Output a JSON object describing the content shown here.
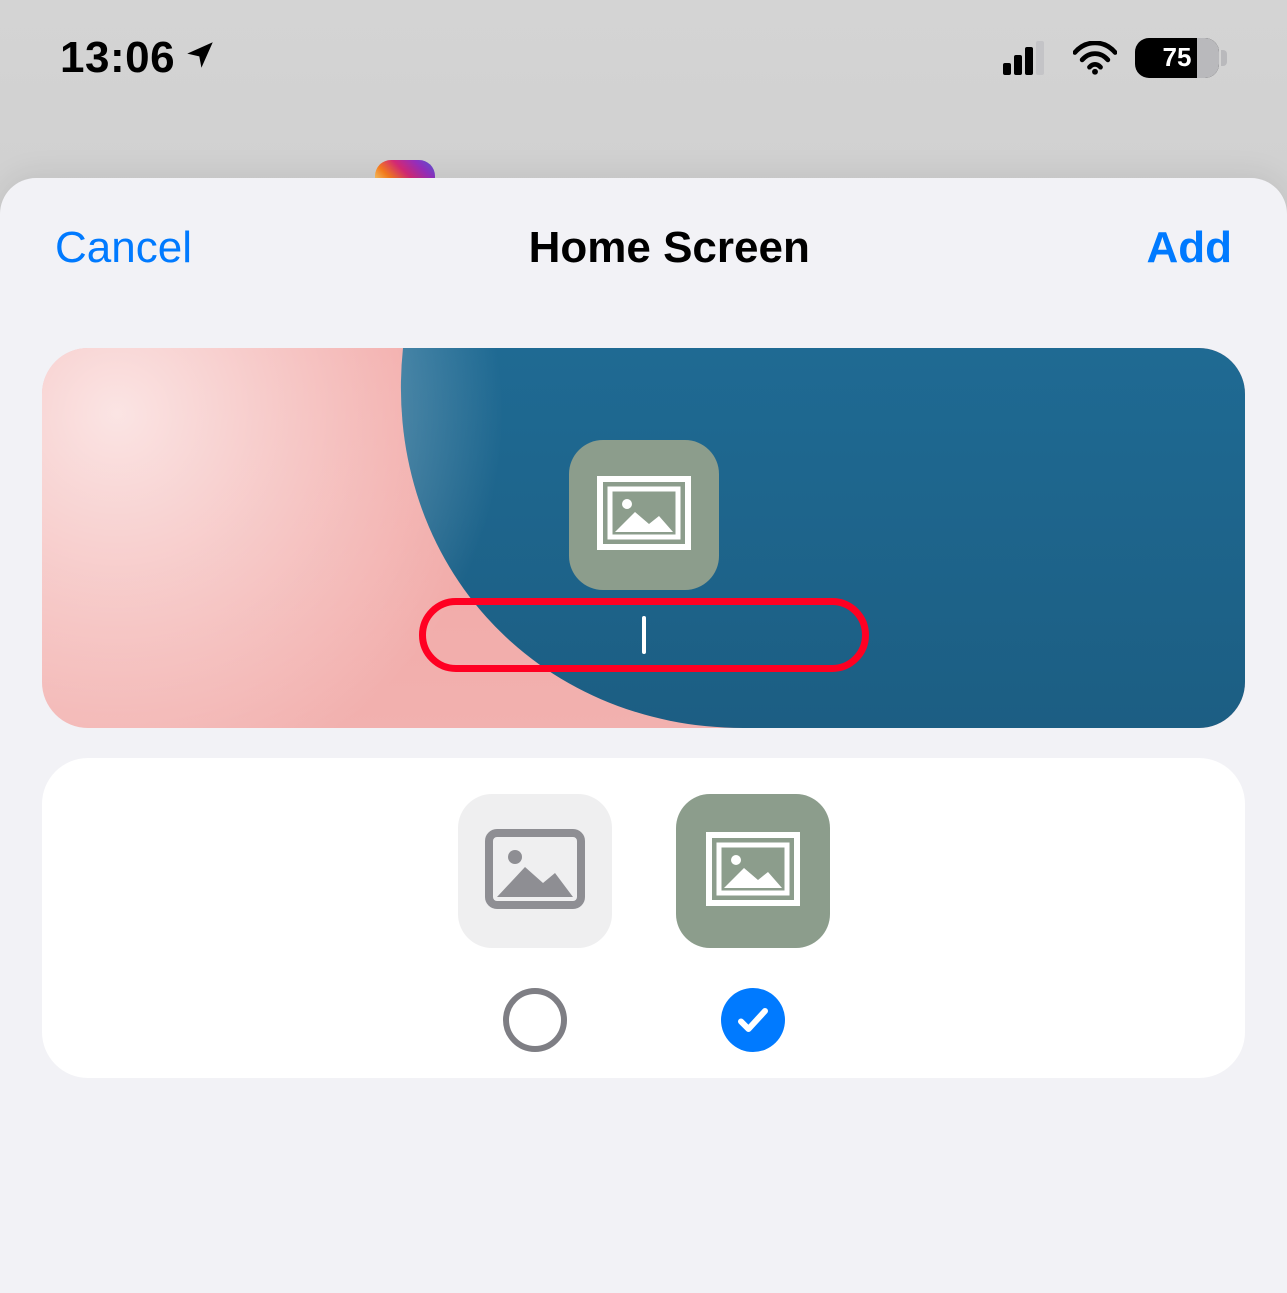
{
  "statusbar": {
    "time": "13:06",
    "battery_percent": "75"
  },
  "sheet": {
    "cancel_label": "Cancel",
    "title": "Home Screen",
    "add_label": "Add",
    "icon_name_value": ""
  },
  "icon_options": {
    "option_a": {
      "selected": false
    },
    "option_b": {
      "selected": true
    }
  },
  "colors": {
    "accent": "#007aff",
    "app_icon_bg": "#8c9d8c",
    "highlight_ring": "#ff0022"
  }
}
